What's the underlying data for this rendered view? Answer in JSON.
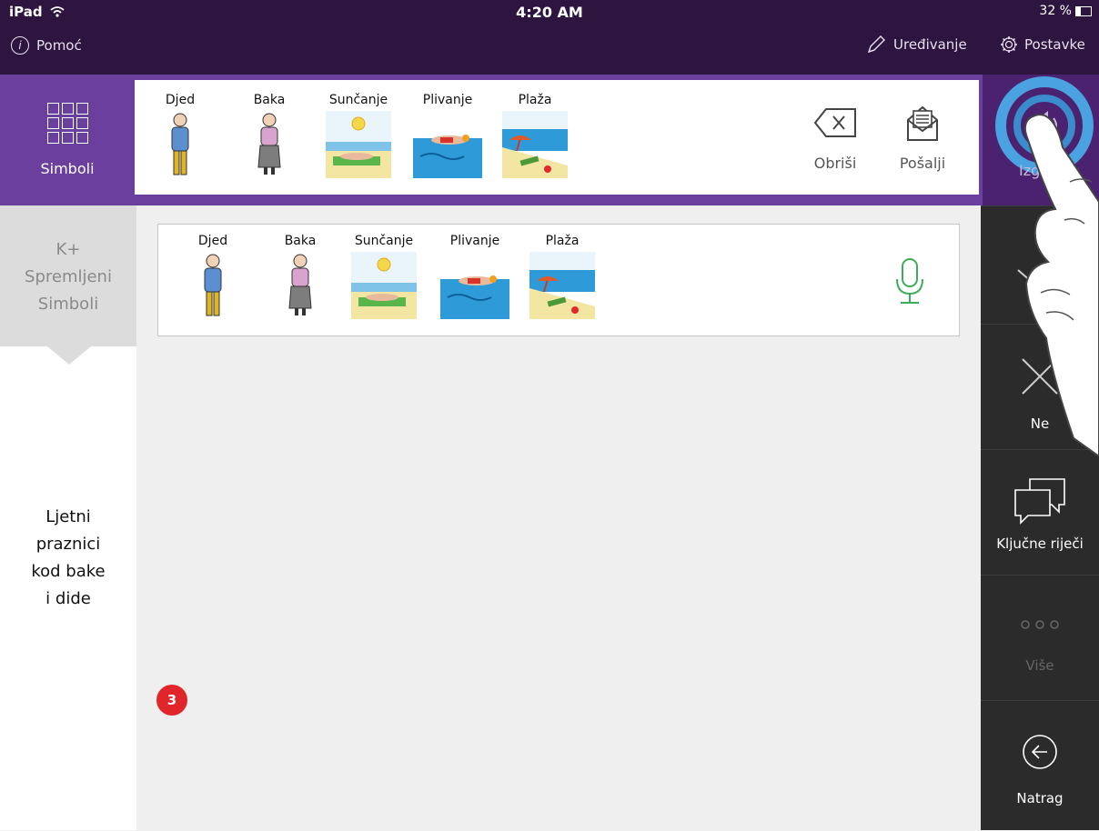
{
  "status_bar": {
    "device": "iPad",
    "time": "4:20 AM",
    "battery": "32 %",
    "battery_level": 0.32
  },
  "top_nav": {
    "help_label": "Pomoć",
    "edit_label": "Uređivanje",
    "settings_label": "Postavke"
  },
  "toolbar": {
    "symbols_button": "Simboli",
    "sentence": [
      {
        "word": "Djed",
        "icon": "grandfather"
      },
      {
        "word": "Baka",
        "icon": "grandmother"
      },
      {
        "word": "Sunčanje",
        "icon": "sunbathing"
      },
      {
        "word": "Plivanje",
        "icon": "swimming"
      },
      {
        "word": "Plaža",
        "icon": "beach"
      }
    ],
    "delete_label": "Obriši",
    "send_label": "Pošalji",
    "speak_label": "Izg"
  },
  "left_panel": {
    "saved_tab_lines": [
      "K+",
      "Spremljeni",
      "Simboli"
    ],
    "board_name_lines": [
      "Ljetni",
      "praznici",
      "kod bake",
      "i dide"
    ]
  },
  "saved_sentence": {
    "symbols": [
      {
        "word": "Djed",
        "icon": "grandfather"
      },
      {
        "word": "Baka",
        "icon": "grandmother"
      },
      {
        "word": "Sunčanje",
        "icon": "sunbathing"
      },
      {
        "word": "Plivanje",
        "icon": "swimming"
      },
      {
        "word": "Plaža",
        "icon": "beach"
      }
    ],
    "mic_icon": "microphone-icon"
  },
  "badge": {
    "count": "3",
    "color": "#e0262a"
  },
  "right_panel": {
    "items": [
      {
        "label": "",
        "icon": "yes-icon"
      },
      {
        "label": "Ne",
        "icon": "no-icon"
      },
      {
        "label": "Ključne riječi",
        "icon": "speech-bubbles-icon"
      },
      {
        "label": "Više",
        "icon": "more-icon"
      },
      {
        "label": "Natrag",
        "icon": "back-arrow-icon"
      }
    ]
  },
  "colors": {
    "status_bg": "#2d1540",
    "toolbar_purple": "#6a3f9e",
    "mic_green": "#3cae5b",
    "right_panel_bg": "#2b2b2b"
  }
}
